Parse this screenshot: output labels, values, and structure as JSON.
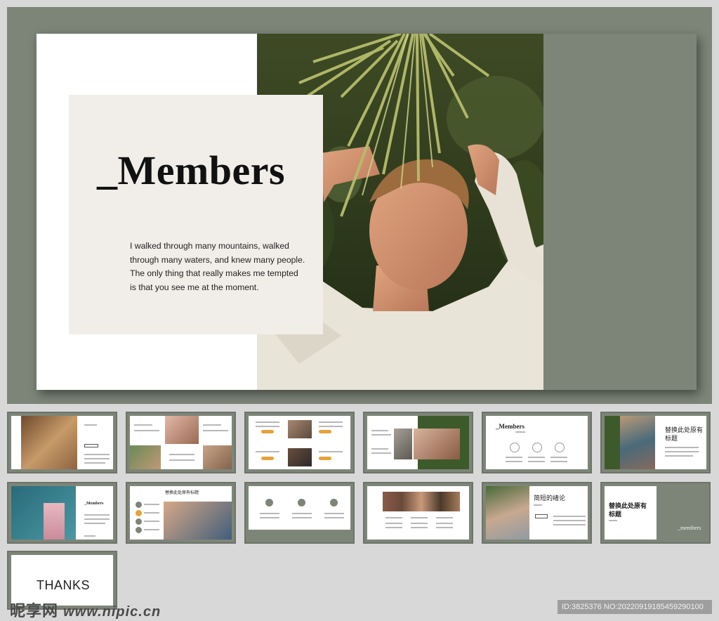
{
  "main_slide": {
    "title": "_Members",
    "body": "I walked through many mountains, walked through many waters, and knew many people. The only thing that really makes me tempted is that you see me at the moment."
  },
  "thumbnails": {
    "t5_title": "_Members",
    "t6_title": "替换此处原有标题",
    "t8_title": "替换此处原有标题",
    "t11_title": "简短的绪论",
    "t12_title": "替换此处原有标题",
    "t12_footer": "_members",
    "t13_title": "THANKS"
  },
  "watermark": {
    "logo": "昵享网",
    "domain": "www.nipic.cn",
    "id": "ID:3825376 NO:20220919185459290100"
  },
  "colors": {
    "sage": "#7d8578",
    "card": "#f1eee9",
    "accent_orange": "#e6a23a",
    "dark_green": "#3d5a2a"
  }
}
